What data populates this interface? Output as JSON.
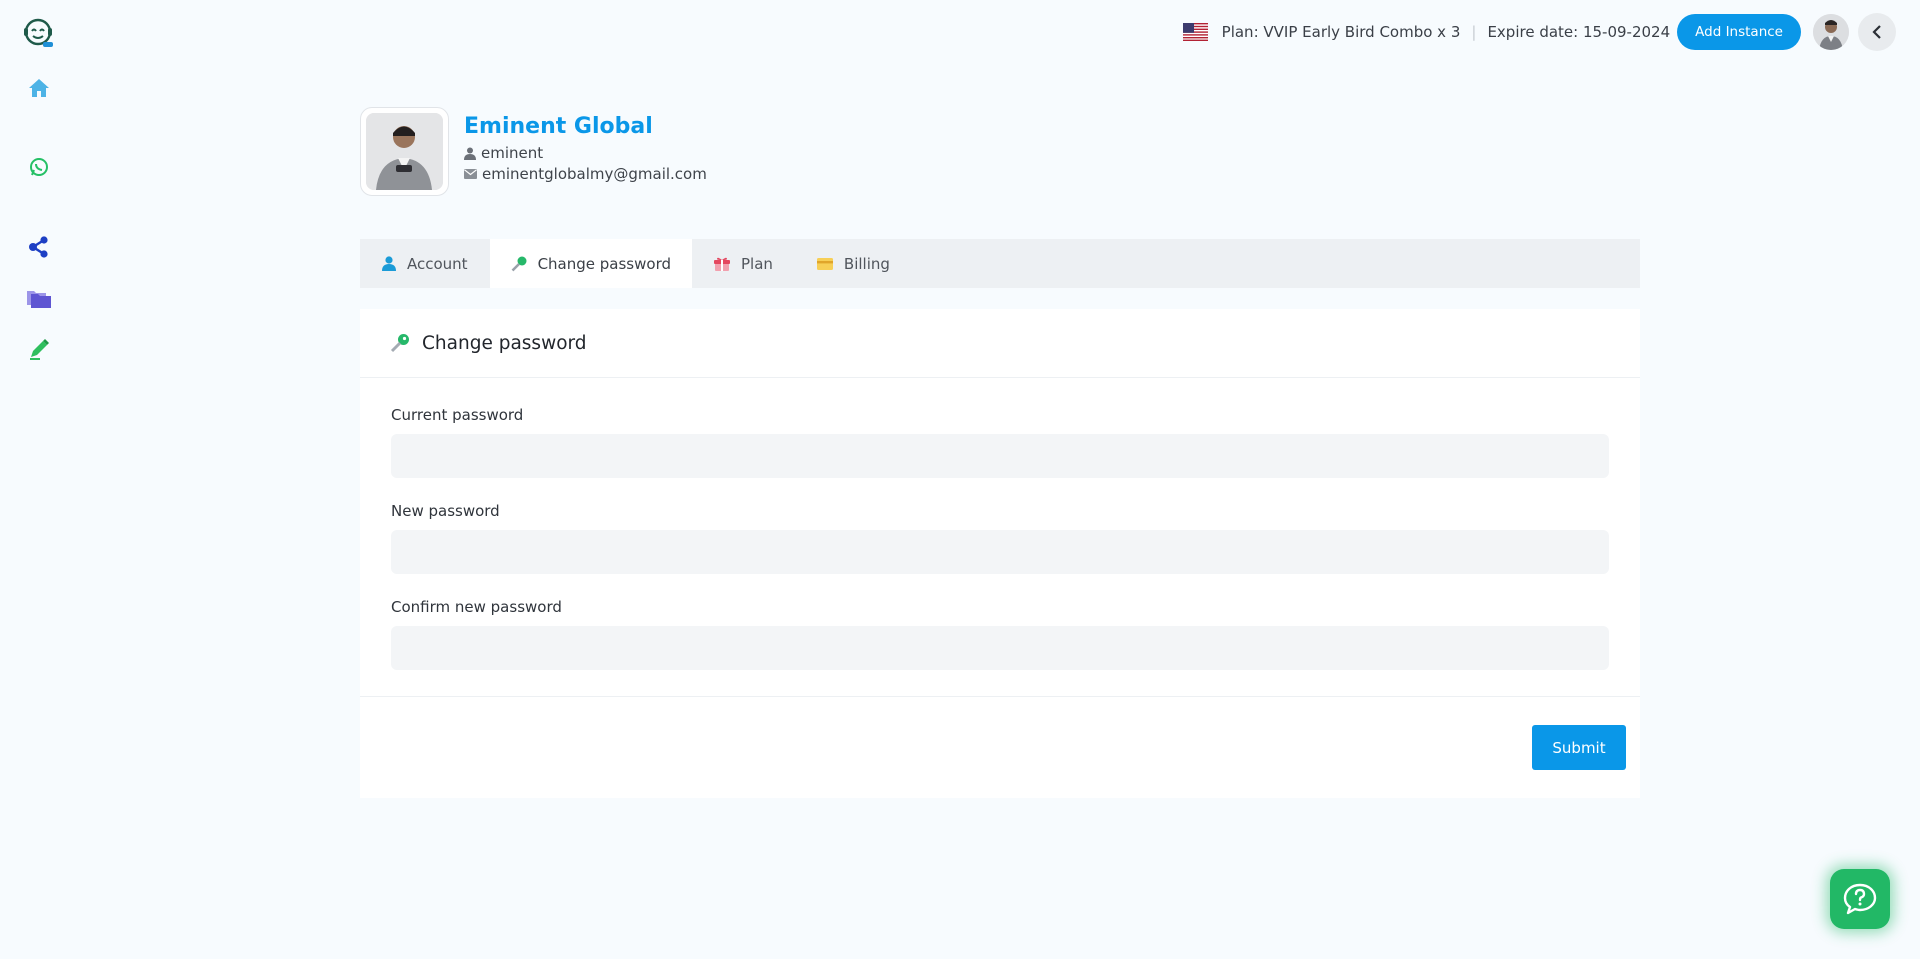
{
  "topbar": {
    "plan_text": "Plan: VVIP Early Bird Combo x 3",
    "separator": "|",
    "expire_text": "Expire date: 15-09-2024",
    "add_instance_label": "Add Instance"
  },
  "sidebar": {
    "items": [
      {
        "icon": "logo-chat-bot-icon"
      },
      {
        "icon": "home-icon",
        "color": "#4db3e6"
      },
      {
        "icon": "whatsapp-icon",
        "color": "#25c066"
      },
      {
        "icon": "share-nodes-icon",
        "color": "#1d3fc4"
      },
      {
        "icon": "folders-icon",
        "color": "#6e63d9"
      },
      {
        "icon": "pen-edit-icon",
        "color": "#2fbf5e"
      }
    ]
  },
  "profile": {
    "name": "Eminent Global",
    "username": "eminent",
    "email": "eminentglobalmy@gmail.com"
  },
  "tabs": [
    {
      "label": "Account",
      "icon": "user-icon",
      "active": false
    },
    {
      "label": "Change password",
      "icon": "key-icon",
      "active": true
    },
    {
      "label": "Plan",
      "icon": "gift-icon",
      "active": false
    },
    {
      "label": "Billing",
      "icon": "credit-card-icon",
      "active": false
    }
  ],
  "card": {
    "title": "Change password",
    "fields": [
      {
        "label": "Current password",
        "value": ""
      },
      {
        "label": "New password",
        "value": ""
      },
      {
        "label": "Confirm new password",
        "value": ""
      }
    ],
    "submit_label": "Submit"
  },
  "colors": {
    "accent": "#0a97e8",
    "help_fab": "#22b866",
    "background": "#f7fbfe"
  }
}
